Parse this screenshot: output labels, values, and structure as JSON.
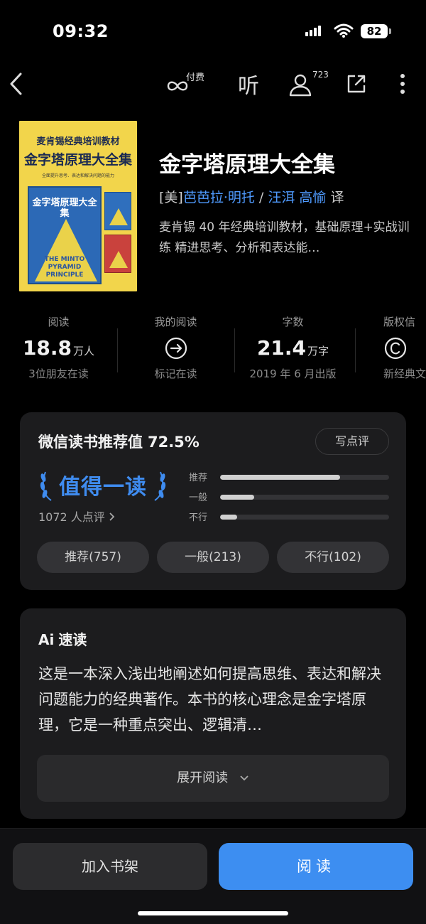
{
  "status": {
    "time": "09:32",
    "battery": "82"
  },
  "toolbar": {
    "pay_label": "付费",
    "listen_label": "听",
    "users_count": "723"
  },
  "book": {
    "title": "金字塔原理大全集",
    "author_prefix": "[美]",
    "author": "芭芭拉·明托",
    "separator": " / ",
    "translators": "汪洱 高愉",
    "translate_suffix": " 译",
    "description": "麦肯锡 40 年经典培训教材，基础原理+实战训练 精进思考、分析和表达能…",
    "cover": {
      "top_line": "麦肯锡经典培训教材",
      "title": "金字塔原理大全集",
      "tagline": "全面提升思考、表达和解决问题的能力",
      "book_title": "金字塔原理大全集",
      "english": "THE MINTO PYRAMID PRINCIPLE"
    }
  },
  "stats": [
    {
      "label": "阅读",
      "value": "18.8",
      "unit": "万人",
      "sub": "3位朋友在读"
    },
    {
      "label": "我的阅读",
      "value": "",
      "unit": "",
      "sub": "标记在读"
    },
    {
      "label": "字数",
      "value": "21.4",
      "unit": "万字",
      "sub": "2019 年 6 月出版"
    },
    {
      "label": "版权信",
      "value": "",
      "unit": "",
      "sub": "新经典文"
    }
  ],
  "recommend": {
    "title": "微信读书推荐值",
    "score": "72.5%",
    "write_review": "写点评",
    "badge": "值得一读",
    "count": "1072 人点评",
    "bars": [
      {
        "label": "推荐",
        "fraction": 0.71
      },
      {
        "label": "一般",
        "fraction": 0.2
      },
      {
        "label": "不行",
        "fraction": 0.1
      }
    ],
    "pills": [
      "推荐(757)",
      "一般(213)",
      "不行(102)"
    ]
  },
  "ai": {
    "mark": "Ai",
    "title": "速读",
    "text": "这是一本深入浅出地阐述如何提高思维、表达和解决问题能力的经典著作。本书的核心理念是金字塔原理，它是一种重点突出、逻辑清…",
    "expand": "展开阅读"
  },
  "actions": {
    "shelf": "加入书架",
    "read": "阅读"
  },
  "colors": {
    "accent": "#3d8ef1",
    "link": "#4f9bff"
  }
}
